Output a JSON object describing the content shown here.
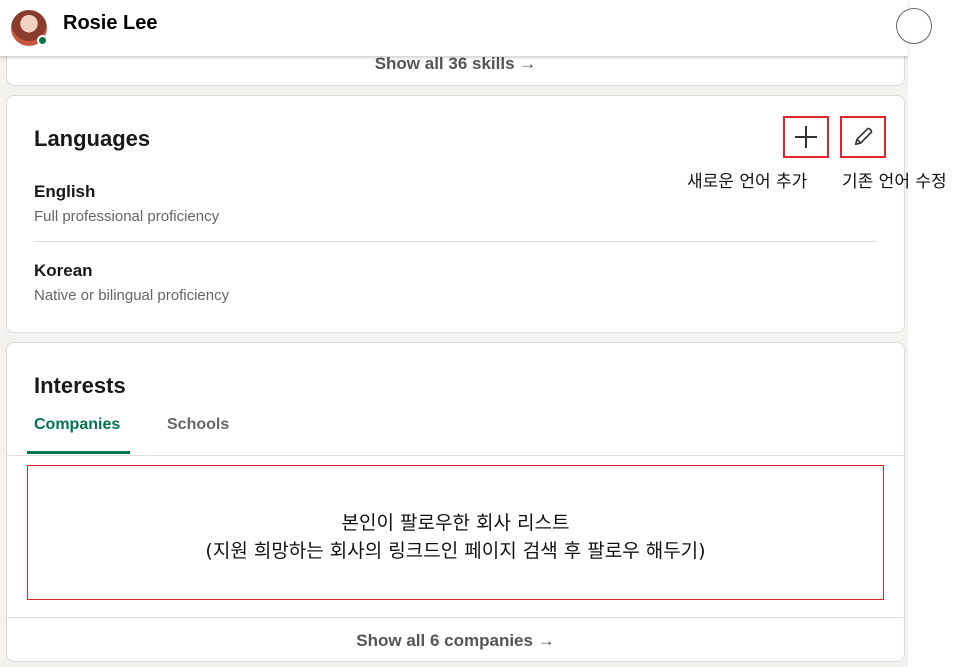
{
  "header": {
    "name": "Rosie Lee"
  },
  "skills": {
    "show_all": "Show all 36 skills →"
  },
  "languages": {
    "title": "Languages",
    "annotations": {
      "add": "새로운 언어 추가",
      "edit": "기존 언어 수정"
    },
    "items": [
      {
        "name": "English",
        "level": "Full professional proficiency"
      },
      {
        "name": "Korean",
        "level": "Native or bilingual proficiency"
      }
    ]
  },
  "interests": {
    "title": "Interests",
    "tabs": [
      {
        "label": "Companies",
        "active": true
      },
      {
        "label": "Schools",
        "active": false
      }
    ],
    "note": {
      "line1": "본인이 팔로우한 회사 리스트",
      "line2": "(지원 희망하는 회사의 링크드인 페이지 검색 후 팔로우 해두기)"
    },
    "show_all": "Show all 6 companies →"
  },
  "colors": {
    "accent_green": "#01754f",
    "annotation_red": "#e0262d",
    "online_status": "#057642"
  }
}
